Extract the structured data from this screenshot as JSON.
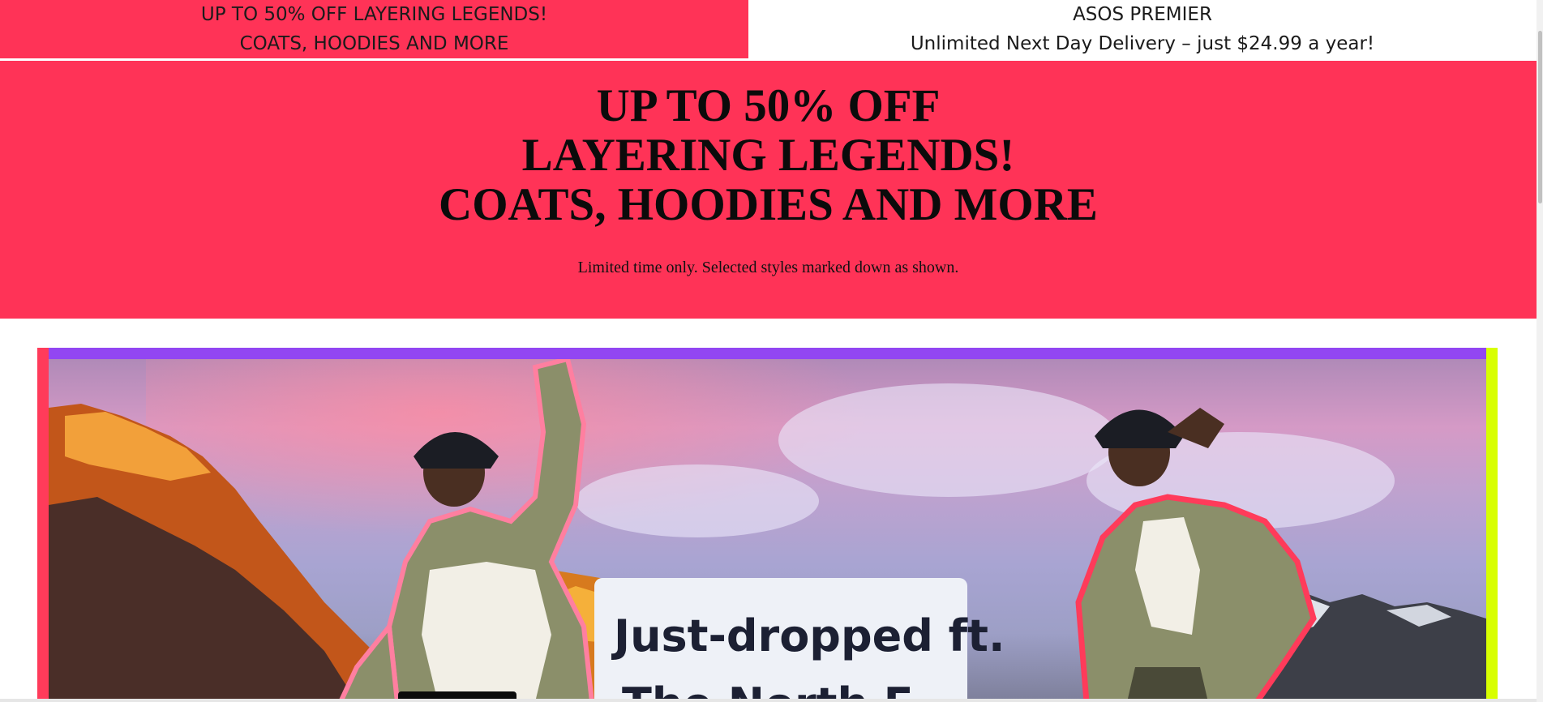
{
  "top_strip": {
    "left_line1": "UP TO 50% OFF LAYERING LEGENDS!",
    "left_line2": "COATS, HOODIES AND MORE",
    "right_line1": "ASOS PREMIER",
    "right_line2": "Unlimited Next Day Delivery – just $24.99 a year!"
  },
  "sale_banner": {
    "title_line1": "UP TO 50% OFF",
    "title_line2": "LAYERING LEGENDS!",
    "title_line3": "COATS, HOODIES AND MORE",
    "subtitle": "Limited time only. Selected styles marked down as shown."
  },
  "hero": {
    "headline_line1": "Just-dropped ft.",
    "headline_line2": "The North F..."
  },
  "colors": {
    "sale_pink": "#ff3357",
    "accent_purple": "#9246f2",
    "accent_lime": "#d8ff00",
    "accent_red": "#ff3b5a"
  }
}
